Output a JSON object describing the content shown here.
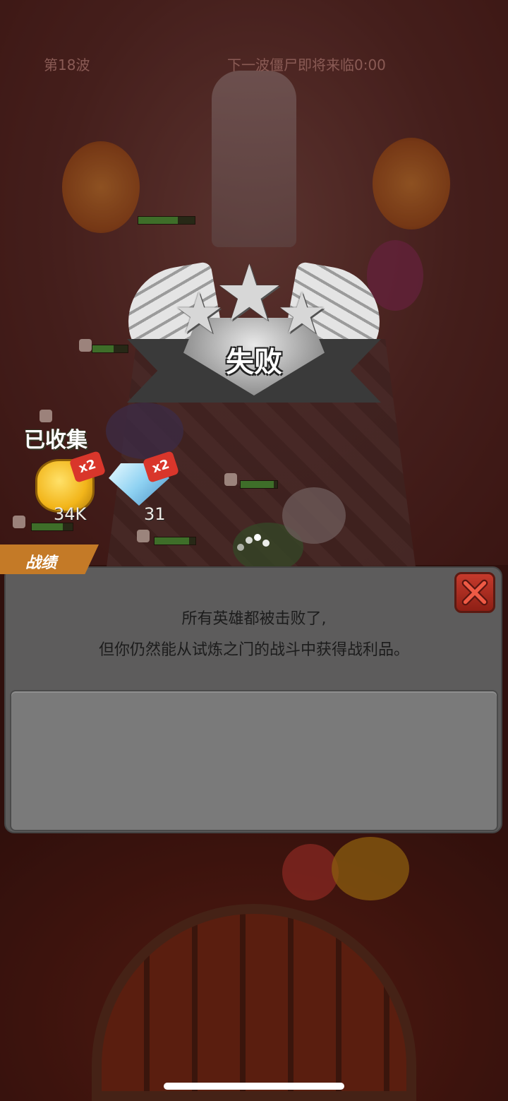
{
  "hud": {
    "wave_label": "第18波",
    "timer_label": "下一波僵尸即将来临0:00"
  },
  "result": {
    "title": "失败",
    "stars_earned": 0,
    "stars_total": 3
  },
  "collected": {
    "label": "已收集",
    "items": [
      {
        "icon": "gold-coin-icon",
        "multiplier": "x2",
        "count": "34K"
      },
      {
        "icon": "diamond-gem-icon",
        "multiplier": "x2",
        "count": "31"
      }
    ]
  },
  "panel": {
    "tab_label": "战绩",
    "message_line1": "所有英雄都被击败了,",
    "message_line2": "但你仍然能从试炼之门的战斗中获得战利品。",
    "close_icon": "close-icon"
  },
  "colors": {
    "tab_orange": "#c47a27",
    "close_red": "#c63a2c",
    "panel_gray": "#5d5c5c"
  }
}
